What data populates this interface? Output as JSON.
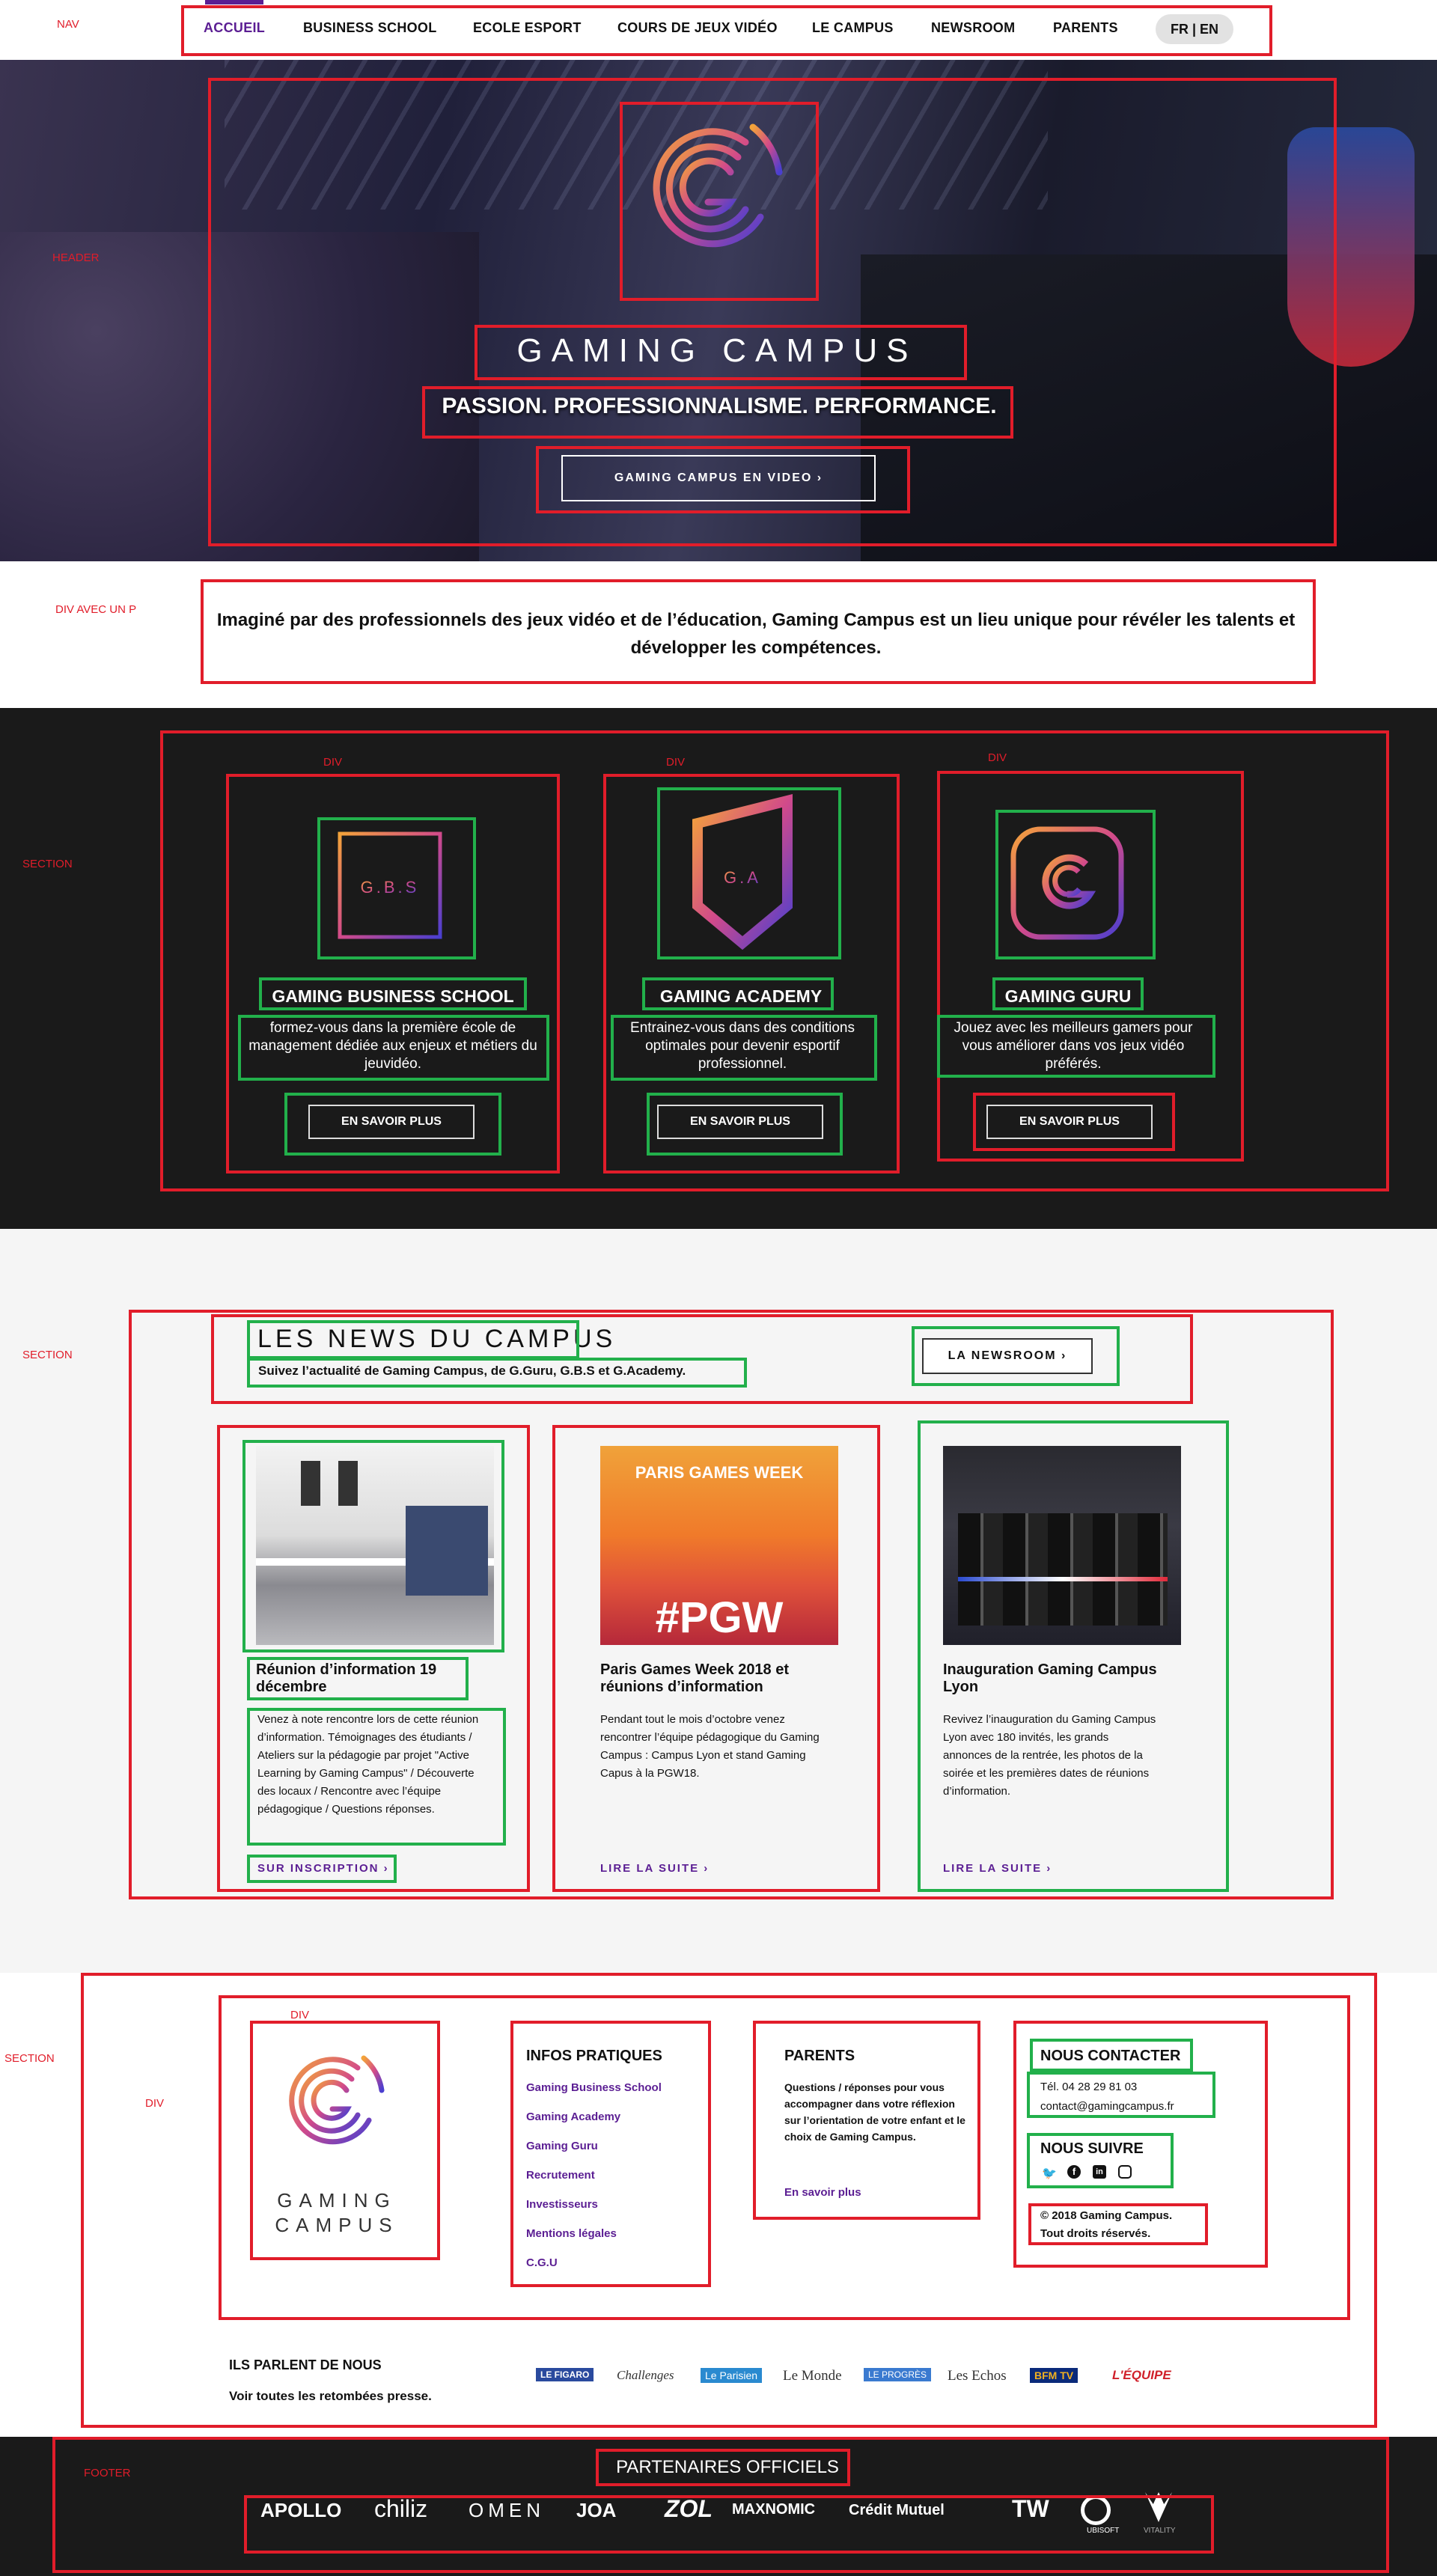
{
  "annotations": {
    "nav": "NAV",
    "header": "HEADER",
    "div_p": "DIV AVEC UN P",
    "section": "SECTION",
    "div": "DIV",
    "footer": "FOOTER"
  },
  "nav": {
    "items": [
      "ACCUEIL",
      "BUSINESS SCHOOL",
      "ECOLE ESPORT",
      "COURS DE JEUX VIDÉO",
      "LE CAMPUS",
      "NEWSROOM",
      "PARENTS"
    ],
    "lang": "FR | EN",
    "active_color": "#5b1e93"
  },
  "hero": {
    "title": "GAMING CAMPUS",
    "slogan": "PASSION. PROFESSIONNALISME. PERFORMANCE.",
    "button": "GAMING CAMPUS EN VIDEO  ›"
  },
  "intro": {
    "text": "Imaginé par des professionnels des jeux vidéo et de l’éducation, Gaming Campus est un lieu unique pour révéler les talents et développer les compétences."
  },
  "schools": [
    {
      "logo_text": "G.B.S",
      "name": "GAMING BUSINESS SCHOOL",
      "desc": "formez-vous dans la première école de management dédiée aux enjeux et métiers du jeuvidéo.",
      "button": "EN SAVOIR PLUS"
    },
    {
      "logo_text": "G.A",
      "name": "GAMING ACADEMY",
      "desc": "Entrainez-vous dans des conditions optimales pour devenir esportif professionnel.",
      "button": "EN SAVOIR PLUS"
    },
    {
      "logo_text": "G",
      "name": "GAMING GURU",
      "desc": "Jouez avec les meilleurs gamers pour vous améliorer dans vos jeux vidéo préférés.",
      "button": "EN SAVOIR PLUS"
    }
  ],
  "news": {
    "title": "LES NEWS DU CAMPUS",
    "subtitle": "Suivez l’actualité de Gaming Campus, de G.Guru, G.B.S et G.Academy.",
    "newsroom_button": "LA NEWSROOM  ›",
    "cards": [
      {
        "title": "Réunion d’information 19 décembre",
        "body": "Venez à note rencontre lors de cette réunion d’information. Témoignages des étudiants / Ateliers sur la pédagogie par projet \"Active Learning by Gaming Campus\" / Découverte des locaux / Rencontre avec l’équipe pédagogique / Questions réponses.",
        "link": "SUR INSCRIPTION  ›"
      },
      {
        "title": "Paris Games Week 2018 et réunions d’information",
        "body": "Pendant tout le mois d’octobre venez rencontrer l’équipe pédagogique du Gaming Campus : Campus Lyon et stand Gaming Capus à la PGW18.",
        "link": "LIRE LA SUITE  ›",
        "image_text_top": "PARIS GAMES WEEK",
        "image_text": "#PGW"
      },
      {
        "title": "Inauguration Gaming Campus Lyon",
        "body": "Revivez l’inauguration du Gaming Campus Lyon avec 180 invités, les grands annonces de la rentrée, les photos de la soirée et les premières dates de réunions d’information.",
        "link": "LIRE LA SUITE  ›"
      }
    ]
  },
  "footer_info": {
    "logo_text_1": "GAMING",
    "logo_text_2": "CAMPUS",
    "infos_title": "INFOS PRATIQUES",
    "infos_links": [
      "Gaming Business School",
      "Gaming Academy",
      "Gaming Guru",
      "Recrutement",
      "Investisseurs",
      "Mentions légales",
      "C.G.U"
    ],
    "parents_title": "PARENTS",
    "parents_text": "Questions / réponses pour vous accompagner dans votre réflexion sur l’orientation de votre enfant et le choix de Gaming Campus.",
    "parents_link": "En savoir plus",
    "contact_title": "NOUS CONTACTER",
    "phone": "Tél. 04 28 29 81 03",
    "email": "contact@gamingcampus.fr",
    "follow_title": "NOUS SUIVRE",
    "social_icons": [
      "twitter-icon",
      "facebook-icon",
      "linkedin-icon",
      "instagram-icon"
    ],
    "copyright_1": "© 2018 Gaming Campus.",
    "copyright_2": "Tout droits réservés.",
    "press_title": "ILS PARLENT DE NOUS",
    "press_link": "Voir toutes les retombées presse.",
    "press": [
      "LE FIGARO",
      "Challenges",
      "Le Parisien",
      "Le Monde",
      "LE PROGRÈS",
      "Les Echos",
      "BFM TV",
      "L'ÉQUIPE"
    ]
  },
  "footer": {
    "partners_title": "PARTENAIRES OFFICIELS",
    "partners": [
      "APOLLO",
      "chiliz",
      "OMEN",
      "JOA",
      "ZOL",
      "MAXNOMIC",
      "Crédit Mutuel",
      "TW",
      "UBISOFT",
      "VITALITY"
    ]
  }
}
